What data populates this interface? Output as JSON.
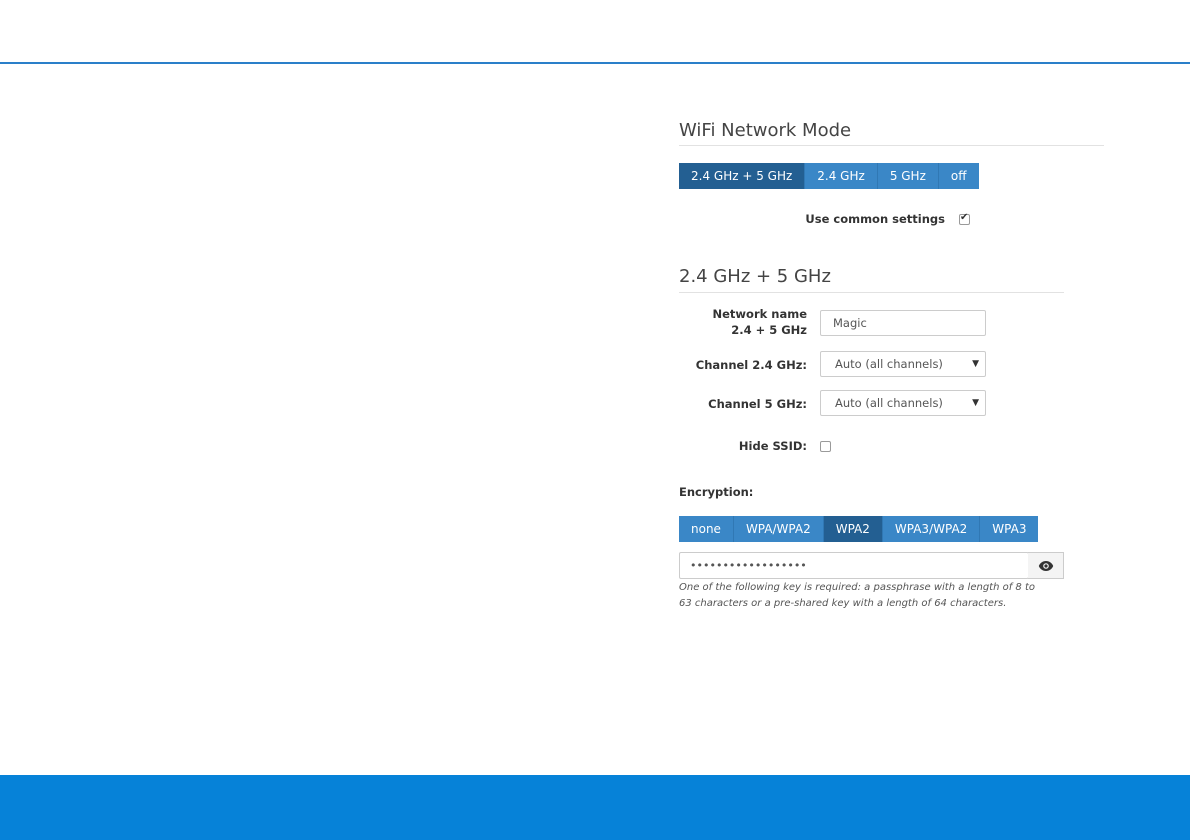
{
  "wifi_mode": {
    "title": "WiFi Network Mode",
    "buttons": [
      "2.4 GHz + 5 GHz",
      "2.4 GHz",
      "5 GHz",
      "off"
    ],
    "active_index": 0,
    "common_settings_label": "Use common settings",
    "common_settings_checked": true
  },
  "band_section": {
    "title": "2.4 GHz + 5 GHz",
    "network_name_label": "Network name 2.4 + 5 GHz",
    "network_name_value": "Magic",
    "channel_24_label": "Channel 2.4 GHz:",
    "channel_24_value": "Auto (all channels)",
    "channel_5_label": "Channel 5 GHz:",
    "channel_5_value": "Auto (all channels)",
    "hide_ssid_label": "Hide SSID:",
    "hide_ssid_checked": false
  },
  "encryption": {
    "label": "Encryption:",
    "buttons": [
      "none",
      "WPA/WPA2",
      "WPA2",
      "WPA3/WPA2",
      "WPA3"
    ],
    "active_index": 2,
    "password_mask": "••••••••••••••••••",
    "show_password_icon": "eye-icon",
    "help_text": "One of the following key is required: a passphrase with a length of 8 to 63 characters or a pre-shared key with a length of 64 characters."
  },
  "colors": {
    "accent": "#3a87c7",
    "accent_active": "#235f92",
    "footer": "#0682d8",
    "top_rule": "#2a7fc9"
  }
}
